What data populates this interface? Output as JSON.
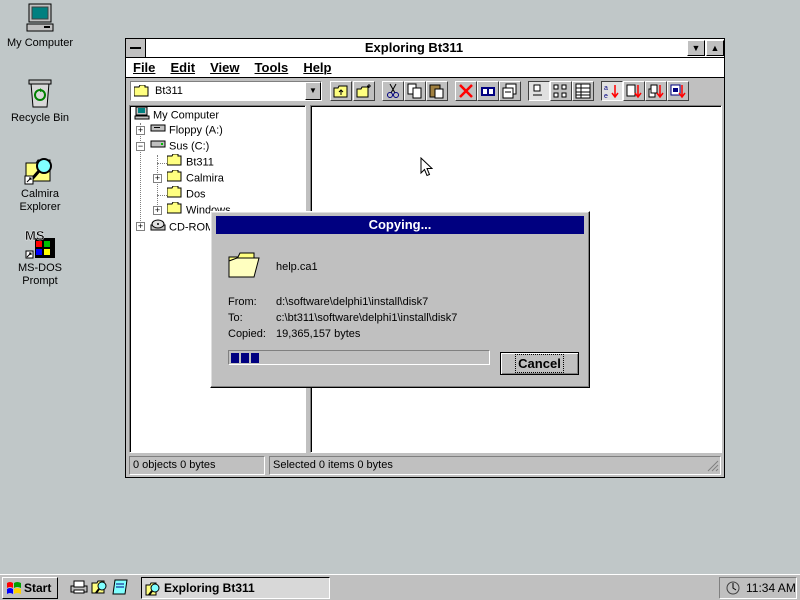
{
  "desktop": {
    "icons": [
      {
        "label": "My Computer"
      },
      {
        "label": "Recycle Bin"
      },
      {
        "label": "Calmira Explorer"
      },
      {
        "label": "MS-DOS Prompt"
      }
    ],
    "msdos_logo_text": "MS"
  },
  "window": {
    "title": "Exploring Bt311",
    "menu": [
      "File",
      "Edit",
      "View",
      "Tools",
      "Help"
    ],
    "location": "Bt311",
    "tree": [
      {
        "label": "My Computer"
      },
      {
        "label": "Floppy (A:)"
      },
      {
        "label": "Sus (C:)"
      },
      {
        "label": "Bt311"
      },
      {
        "label": "Calmira"
      },
      {
        "label": "Dos"
      },
      {
        "label": "Windows"
      },
      {
        "label": "CD-ROM"
      }
    ],
    "status_left": "0 objects  0 bytes",
    "status_right": "Selected 0 items  0 bytes"
  },
  "dialog": {
    "title": "Copying...",
    "filename": "help.ca1",
    "from_label": "From:",
    "from_value": "d:\\software\\delphi1\\install\\disk7",
    "to_label": "To:",
    "to_value": "c:\\bt311\\software\\delphi1\\install\\disk7",
    "copied_label": "Copied:",
    "copied_value": "19,365,157 bytes",
    "progress_blocks": 3,
    "cancel_label": "Cancel"
  },
  "taskbar": {
    "start_label": "Start",
    "task_label": "Exploring Bt311",
    "clock": "11:34 AM"
  },
  "colors": {
    "desktop": "#c0c7c8",
    "dialog_title": "#000080",
    "progress": "#000080"
  }
}
